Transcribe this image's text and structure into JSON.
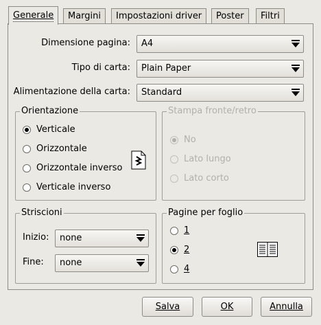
{
  "tabs": [
    {
      "label": "Generale",
      "active": true
    },
    {
      "label": "Margini",
      "active": false
    },
    {
      "label": "Impostazioni driver",
      "active": false
    },
    {
      "label": "Poster",
      "active": false
    },
    {
      "label": "Filtri",
      "active": false
    }
  ],
  "general": {
    "page_size": {
      "label": "Dimensione pagina:",
      "value": "A4"
    },
    "paper_type": {
      "label": "Tipo di carta:",
      "value": "Plain Paper"
    },
    "paper_source": {
      "label": "Alimentazione della carta:",
      "value": "Standard"
    }
  },
  "orientation": {
    "title": "Orientazione",
    "options": [
      {
        "label": "Verticale",
        "selected": true
      },
      {
        "label": "Orizzontale",
        "selected": false
      },
      {
        "label": "Orizzontale inverso",
        "selected": false
      },
      {
        "label": "Verticale inverso",
        "selected": false
      }
    ],
    "preview_icon": "page-portrait-icon"
  },
  "duplex": {
    "title": "Stampa fronte/retro",
    "enabled": false,
    "options": [
      {
        "label": "No",
        "selected": true
      },
      {
        "label": "Lato lungo",
        "selected": false
      },
      {
        "label": "Lato corto",
        "selected": false
      }
    ]
  },
  "banners": {
    "title": "Striscioni",
    "start": {
      "label": "Inizio:",
      "value": "none"
    },
    "end": {
      "label": "Fine:",
      "value": "none"
    }
  },
  "pages_per_sheet": {
    "title": "Pagine per foglio",
    "options": [
      {
        "label": "1",
        "selected": false
      },
      {
        "label": "2",
        "selected": true
      },
      {
        "label": "4",
        "selected": false
      }
    ],
    "preview_icon": "two-up-layout-icon"
  },
  "buttons": {
    "save": "Salva",
    "ok": "OK",
    "cancel": "Annulla"
  }
}
